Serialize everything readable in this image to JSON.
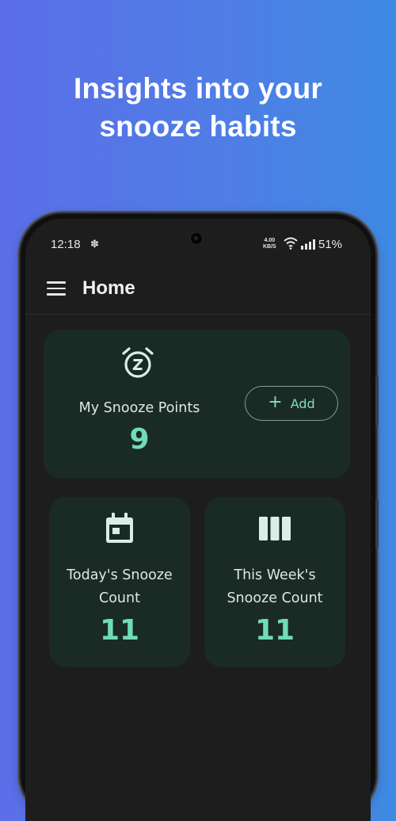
{
  "headline": {
    "line1": "Insights into your",
    "line2": "snooze habits"
  },
  "status_bar": {
    "time": "12:18",
    "notification_icon": "slack-icon",
    "speed_value": "4.00",
    "speed_unit": "KB/S",
    "battery": "51%"
  },
  "app_bar": {
    "title": "Home",
    "menu_icon": "hamburger-menu-icon"
  },
  "points_card": {
    "icon": "alarm-snooze-icon",
    "label": "My Snooze Points",
    "value": "9",
    "add_button": {
      "icon": "plus-icon",
      "label": "Add"
    }
  },
  "today_card": {
    "icon": "calendar-today-icon",
    "label_line1": "Today's Snooze",
    "label_line2": "Count",
    "value": "11"
  },
  "week_card": {
    "icon": "week-view-icon",
    "label_line1": "This Week's",
    "label_line2": "Snooze Count",
    "value": "11"
  },
  "colors": {
    "background_start": "#5b6ee8",
    "background_end": "#3f8ae2",
    "screen": "#1d1d1d",
    "card": "#1a2a25",
    "accent": "#6fdcb4",
    "icon": "#d9efe6"
  }
}
